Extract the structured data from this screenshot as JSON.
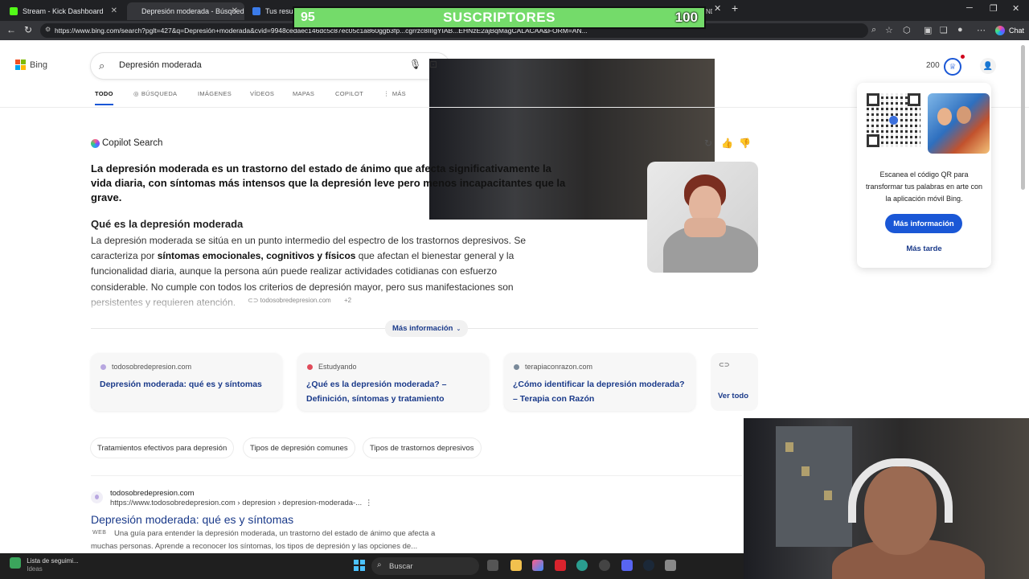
{
  "browser": {
    "tabs": [
      {
        "label": "Stream - Kick Dashboard",
        "favicon_color": "#53fc18"
      },
      {
        "label": "Depresión moderada - Búsqueda",
        "favicon_color": "#35363a"
      },
      {
        "label": "Tus resultac",
        "favicon_color": "#e9a23b"
      }
    ],
    "hidden_tab_fragment": "a con IND",
    "url": "https://www.bing.com/search?pglt=427&q=Depresión+moderada&cvid=9948cedaec146dc5c87ec05c1a860ggb3fp...cgrrzc8IIIgYIAB...EHNzE2ajBqMagCALACAA&FORM=AN...",
    "chat_label": "Chat"
  },
  "overlay": {
    "subs_current": "95",
    "subs_label": "SUSCRIPTORES",
    "subs_goal": "100"
  },
  "bing": {
    "logo_text": "Bing",
    "query": "Depresión moderada",
    "points": "200",
    "nav": [
      "TODO",
      "BÚSQUEDA",
      "IMÁGENES",
      "VÍDEOS",
      "MAPAS",
      "COPILOT",
      "MÁS"
    ]
  },
  "copilot": {
    "label": "Copilot Search",
    "answer": "La depresión moderada es un trastorno del estado de ánimo que afecta significativamente la vida diaria, con síntomas más intensos que la depresión leve pero menos incapacitantes que la grave.",
    "heading": "Qué es la depresión moderada",
    "para_1": "La depresión moderada se sitúa en un punto intermedio del espectro de los trastornos depresivos. Se caracteriza por ",
    "para_bold": "síntomas emocionales, cognitivos y físicos",
    "para_2": " que afectan el bienestar general y la funcionalidad diaria, aunque la persona aún puede realizar actividades cotidianas con esfuerzo considerable. No cumple con todos los criterios de depresión mayor, pero sus manifestaciones son persistentes y requieren atención.",
    "citation": "todosobredepresion.com",
    "citation_more": "+2",
    "more_info": "Más información"
  },
  "sources": [
    {
      "domain": "todosobredepresion.com",
      "title": "Depresión moderada: qué es y síntomas",
      "color": "#b8a7e0"
    },
    {
      "domain": "Estudyando",
      "title": "¿Qué es la depresión moderada? – Definición, síntomas y tratamiento",
      "color": "#e04b5a"
    },
    {
      "domain": "terapiaconrazon.com",
      "title": "¿Cómo identificar la depresión moderada? – Terapia con Razón",
      "color": "#7a8a9a"
    }
  ],
  "see_all": "Ver todo",
  "chips": [
    "Tratamientos efectivos para depresión",
    "Tipos de depresión comunes",
    "Tipos de trastornos depresivos"
  ],
  "result": {
    "site": "todosobredepresion.com",
    "url": "https://www.todosobredepresion.com › depresion › depresion-moderada-...",
    "title": "Depresión moderada: qué es y síntomas",
    "tag": "WEB",
    "desc": "Una guía para entender la depresión moderada, un trastorno del estado de ánimo que afecta a muchas personas. Aprende a reconocer los síntomas, los tipos de depresión y las opciones de..."
  },
  "qr_popup": {
    "text": "Escanea el código QR para transformar tus palabras en arte con la aplicación móvil Bing.",
    "button": "Más información",
    "later": "Más tarde"
  },
  "taskbar": {
    "watchlist": "Lista de seguimi...",
    "watchlist_sub": "Ideas",
    "search": "Buscar"
  },
  "colors": {
    "accent": "#1a57d6",
    "link": "#1a3a8a",
    "overlay_green": "#74db6a"
  }
}
